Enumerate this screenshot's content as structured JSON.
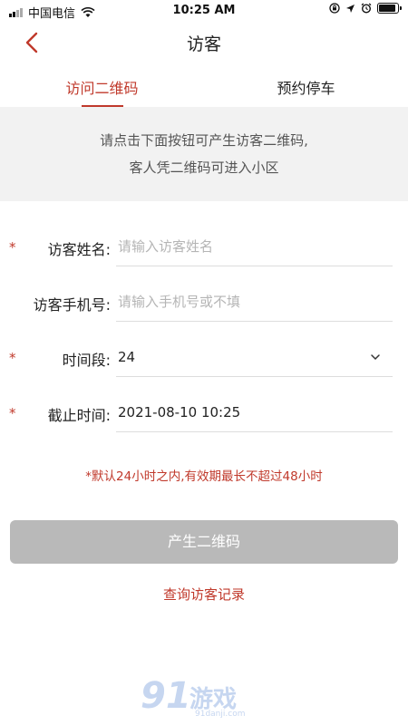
{
  "status_bar": {
    "carrier": "中国电信",
    "time": "10:25 AM"
  },
  "nav": {
    "title": "访客"
  },
  "tabs": [
    {
      "label": "访问二维码",
      "active": true
    },
    {
      "label": "预约停车",
      "active": false
    }
  ],
  "notice": {
    "line1": "请点击下面按钮可产生访客二维码,",
    "line2": "客人凭二维码可进入小区"
  },
  "form": {
    "required_mark": "*",
    "name": {
      "label": "访客姓名:",
      "placeholder": "请输入访客姓名",
      "value": ""
    },
    "phone": {
      "label": "访客手机号:",
      "placeholder": "请输入手机号或不填",
      "value": ""
    },
    "period": {
      "label": "时间段:",
      "value": "24"
    },
    "deadline": {
      "label": "截止时间:",
      "value": "2021-08-10 10:25"
    }
  },
  "hint": "*默认24小时之内,有效期最长不超过48小时",
  "generate_button": "产生二维码",
  "history_link": "查询访客记录",
  "watermark": {
    "mark": "91",
    "text": "游戏",
    "url": "91danji.com"
  },
  "colors": {
    "accent": "#c0392b",
    "button_disabled": "#b9b9b9",
    "notice_bg": "#f2f2f2"
  }
}
